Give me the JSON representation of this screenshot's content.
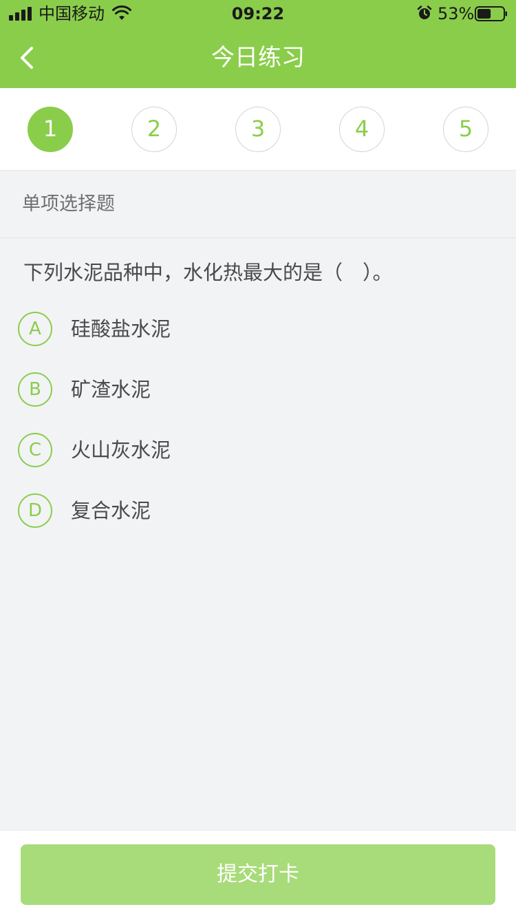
{
  "status_bar": {
    "carrier": "中国移动",
    "time": "09:22",
    "battery_percent": "53%",
    "battery_level": 0.53,
    "icons": [
      "signal-icon",
      "wifi-icon",
      "alarm-icon",
      "battery-icon"
    ]
  },
  "nav": {
    "title": "今日练习",
    "back_icon": "chevron-left-icon"
  },
  "steps": {
    "items": [
      "1",
      "2",
      "3",
      "4",
      "5"
    ],
    "active_index": 0
  },
  "section": {
    "label": "单项选择题"
  },
  "question": {
    "text": "下列水泥品种中，水化热最大的是（　）。",
    "options": [
      {
        "letter": "A",
        "text": "硅酸盐水泥"
      },
      {
        "letter": "B",
        "text": "矿渣水泥"
      },
      {
        "letter": "C",
        "text": "火山灰水泥"
      },
      {
        "letter": "D",
        "text": "复合水泥"
      }
    ]
  },
  "submit": {
    "label": "提交打卡"
  },
  "colors": {
    "accent": "#8acd4b",
    "button_disabled": "#a8db7a",
    "background": "#f2f3f5",
    "text": "#4a4a4a"
  }
}
